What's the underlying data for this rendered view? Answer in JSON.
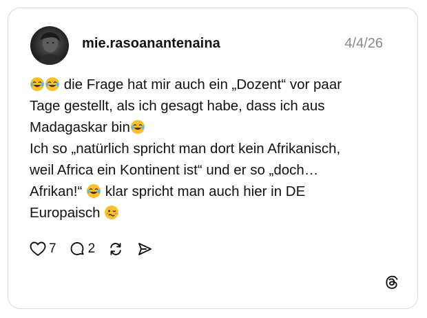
{
  "post": {
    "username": "mie.rasoanantenaina",
    "date": "4/4/26",
    "lines": [
      "die Frage hat mir auch ein „Dozent“ vor paar",
      "Tage gestellt, als ich gesagt habe, dass ich aus",
      "Madagaskar bin",
      "Ich so „natürlich spricht man dort kein Afrikanisch,",
      "weil Africa ein Kontinent ist“ und er so „doch…",
      "Afrikan!“",
      "klar spricht man auch hier in DE",
      "Europaisch"
    ],
    "emojis": {
      "laughing": "face-with-tears-of-joy",
      "woozy": "woozy-face"
    }
  },
  "actions": {
    "like_icon": "heart-icon",
    "like_count": "7",
    "reply_icon": "comment-icon",
    "reply_count": "2",
    "repost_icon": "repost-icon",
    "share_icon": "send-icon"
  },
  "brand": {
    "logo": "threads-logo-icon"
  }
}
